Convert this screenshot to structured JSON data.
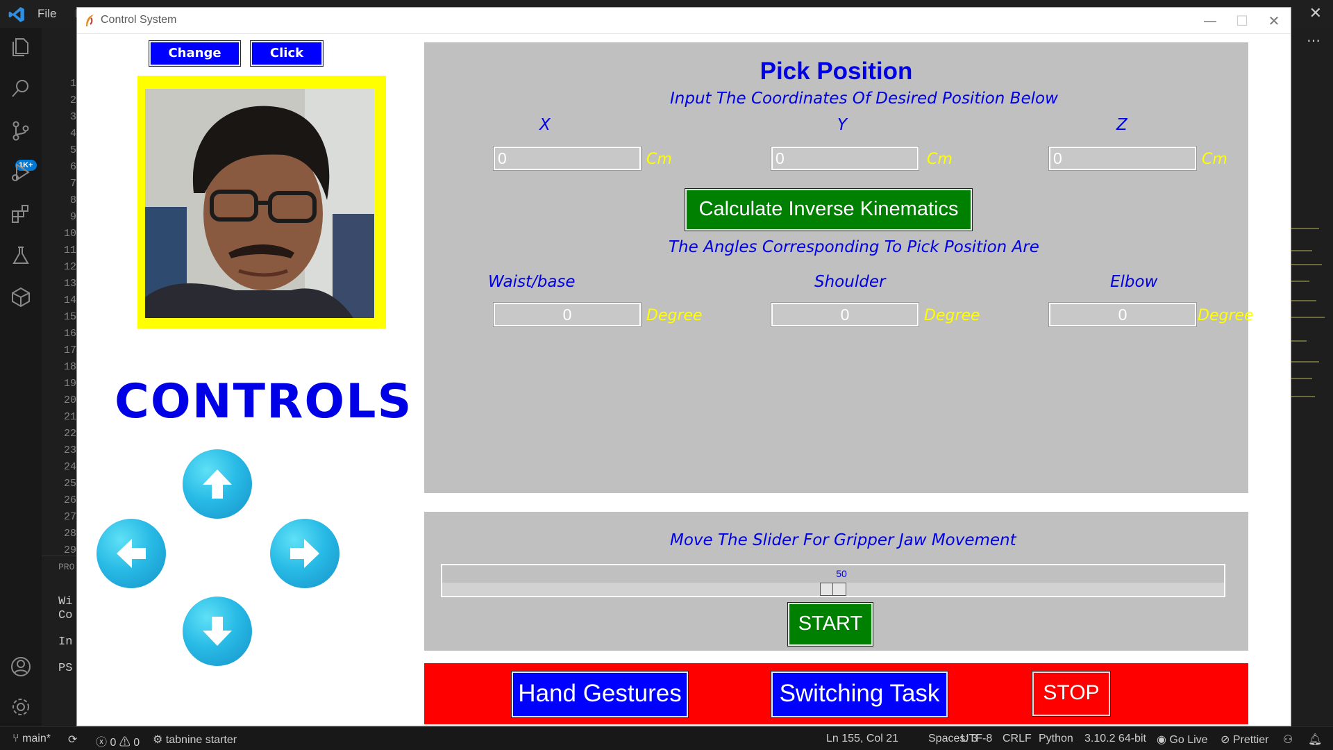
{
  "vscode": {
    "menu": [
      "File",
      "E"
    ],
    "line_numbers": [
      "1",
      "2",
      "3",
      "4",
      "5",
      "6",
      "7",
      "8",
      "9",
      "10",
      "11",
      "12",
      "13",
      "14",
      "15",
      "16",
      "17",
      "18",
      "19",
      "20",
      "21",
      "22",
      "23",
      "24",
      "25",
      "26",
      "27",
      "28",
      "29"
    ],
    "panel_lines": [
      "PRO",
      "Wi",
      "Co",
      "In",
      "PS"
    ],
    "activity_badge": "1K+",
    "status": {
      "branch": "main*",
      "errors": "0",
      "warnings": "0",
      "tabnine": "tabnine starter",
      "position": "Ln 155, Col 21",
      "spaces": "Spaces: 3",
      "encoding": "UTF-8",
      "eol": "CRLF",
      "language": "Python",
      "interpreter": "3.10.2 64-bit",
      "golive": "Go Live",
      "prettier": "Prettier"
    }
  },
  "app": {
    "title": "Control System",
    "change_camera": "Change Camera",
    "click_picture": "Click Picture",
    "controls_heading": "CONTROLS",
    "pick": {
      "heading": "Pick Position",
      "instruction": "Input The Coordinates Of Desired Position Below",
      "x_label": "X",
      "y_label": "Y",
      "z_label": "Z",
      "x_value": "0",
      "y_value": "0",
      "z_value": "0",
      "coord_unit": "Cm",
      "calc_button": "Calculate Inverse Kinematics",
      "angles_heading": "The Angles Corresponding To Pick Position Are",
      "waist_label": "Waist/base",
      "shoulder_label": "Shoulder",
      "elbow_label": "Elbow",
      "waist_value": "0",
      "shoulder_value": "0",
      "elbow_value": "0",
      "angle_unit": "Degree"
    },
    "gripper": {
      "instruction": "Move The Slider For Gripper Jaw Movement",
      "slider_value": "50",
      "start_button": "START"
    },
    "actions": {
      "hand_gestures": "Hand Gestures",
      "switching_task": "Switching Task",
      "stop": "STOP"
    }
  },
  "colors": {
    "accent_blue": "#0000e6",
    "button_blue": "#0000ff",
    "button_green": "#008000",
    "bar_red": "#ff0000",
    "frame_yellow": "#ffff00",
    "panel_gray": "#c0c0c0"
  }
}
